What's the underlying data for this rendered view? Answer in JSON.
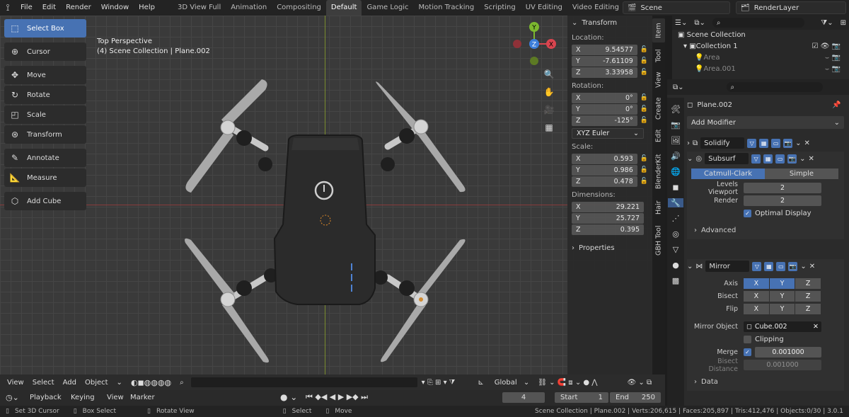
{
  "topbar": {
    "menus": [
      "File",
      "Edit",
      "Render",
      "Window",
      "Help"
    ],
    "workspaces": [
      {
        "label": "3D View Full",
        "active": false
      },
      {
        "label": "Animation",
        "active": false
      },
      {
        "label": "Compositing",
        "active": false
      },
      {
        "label": "Default",
        "active": true
      },
      {
        "label": "Game Logic",
        "active": false
      },
      {
        "label": "Motion Tracking",
        "active": false
      },
      {
        "label": "Scripting",
        "active": false
      },
      {
        "label": "UV Editing",
        "active": false
      },
      {
        "label": "Video Editing",
        "active": false
      }
    ],
    "add_tab": "+",
    "scene": "Scene",
    "render_layer": "RenderLayer"
  },
  "viewport": {
    "info_line1": "Top Perspective",
    "info_line2": "(4) Scene Collection | Plane.002",
    "gizmo": {
      "x": "X",
      "y": "Y",
      "z": "Z"
    }
  },
  "toolbar": {
    "tools": [
      {
        "label": "Select Box",
        "icon": "select-box-icon",
        "glyph": "⬚",
        "active": true
      },
      {
        "label": "Cursor",
        "icon": "cursor-icon",
        "glyph": "⊕",
        "active": false
      },
      {
        "label": "Move",
        "icon": "move-icon",
        "glyph": "✥",
        "active": false
      },
      {
        "label": "Rotate",
        "icon": "rotate-icon",
        "glyph": "↻",
        "active": false
      },
      {
        "label": "Scale",
        "icon": "scale-icon",
        "glyph": "◰",
        "active": false
      },
      {
        "label": "Transform",
        "icon": "transform-icon",
        "glyph": "⊛",
        "active": false
      },
      {
        "label": "Annotate",
        "icon": "annotate-icon",
        "glyph": "✎",
        "active": false
      },
      {
        "label": "Measure",
        "icon": "measure-icon",
        "glyph": "📐",
        "active": false
      },
      {
        "label": "Add Cube",
        "icon": "add-cube-icon",
        "glyph": "⬡",
        "active": false
      }
    ]
  },
  "npanel": {
    "header": "Transform",
    "location_label": "Location:",
    "location": [
      {
        "axis": "X",
        "value": "9.54577"
      },
      {
        "axis": "Y",
        "value": "-7.61109"
      },
      {
        "axis": "Z",
        "value": "3.33958"
      }
    ],
    "rotation_label": "Rotation:",
    "rotation": [
      {
        "axis": "X",
        "value": "0°"
      },
      {
        "axis": "Y",
        "value": "0°"
      },
      {
        "axis": "Z",
        "value": "-125°"
      }
    ],
    "rotation_mode": "XYZ Euler",
    "scale_label": "Scale:",
    "scale": [
      {
        "axis": "X",
        "value": "0.593"
      },
      {
        "axis": "Y",
        "value": "0.986"
      },
      {
        "axis": "Z",
        "value": "0.478"
      }
    ],
    "dimensions_label": "Dimensions:",
    "dimensions": [
      {
        "axis": "X",
        "value": "29.221"
      },
      {
        "axis": "Y",
        "value": "25.727"
      },
      {
        "axis": "Z",
        "value": "0.395"
      }
    ],
    "properties": "Properties"
  },
  "sidetabs": [
    "Item",
    "Tool",
    "View",
    "Create",
    "Edit",
    "BlenderKit",
    "Hair",
    "GBH Tool"
  ],
  "viewport_header": {
    "items": [
      "View",
      "Select",
      "Add",
      "Object"
    ],
    "orientation": "Global"
  },
  "timeline": {
    "menus": [
      "Playback",
      "Keying",
      "View",
      "Marker"
    ],
    "frame": "4",
    "start_label": "Start",
    "start": "1",
    "end_label": "End",
    "end": "250"
  },
  "statusbar": {
    "hint1": "Set 3D Cursor",
    "hint2": "Box Select",
    "hint3": "Rotate View",
    "hint4": "Select",
    "hint5": "Move",
    "stats": "Scene Collection | Plane.002 | Verts:206,615 | Faces:205,897 | Tris:412,476 | Objects:0/30 | 3.0.1"
  },
  "outliner": {
    "items": [
      {
        "label": "Scene Collection",
        "indent": 0
      },
      {
        "label": "Collection 1",
        "indent": 1
      },
      {
        "label": "Area",
        "indent": 2
      },
      {
        "label": "Area.001",
        "indent": 2
      }
    ]
  },
  "properties": {
    "object_name": "Plane.002",
    "add_modifier": "Add Modifier",
    "modifiers": {
      "solidify": "Solidify",
      "subsurf": "Subsurf",
      "mirror": "Mirror"
    },
    "subsurf": {
      "catmull": "Catmull-Clark",
      "simple": "Simple",
      "levels_label": "Levels Viewport",
      "levels": "2",
      "render_label": "Render",
      "render": "2",
      "optimal": "Optimal Display",
      "advanced": "Advanced"
    },
    "mirror": {
      "axis_label": "Axis",
      "bisect_label": "Bisect",
      "flip_label": "Flip",
      "x": "X",
      "y": "Y",
      "z": "Z",
      "object_label": "Mirror Object",
      "object": "Cube.002",
      "clipping": "Clipping",
      "merge_label": "Merge",
      "merge": "0.001000",
      "bisect_dist_label": "Bisect Distance",
      "bisect_dist": "0.001000",
      "data": "Data"
    }
  },
  "colors": {
    "accent": "#4772b3",
    "x_axis": "#d9454f",
    "y_axis": "#7cb82f",
    "z_axis": "#3c7edb"
  }
}
